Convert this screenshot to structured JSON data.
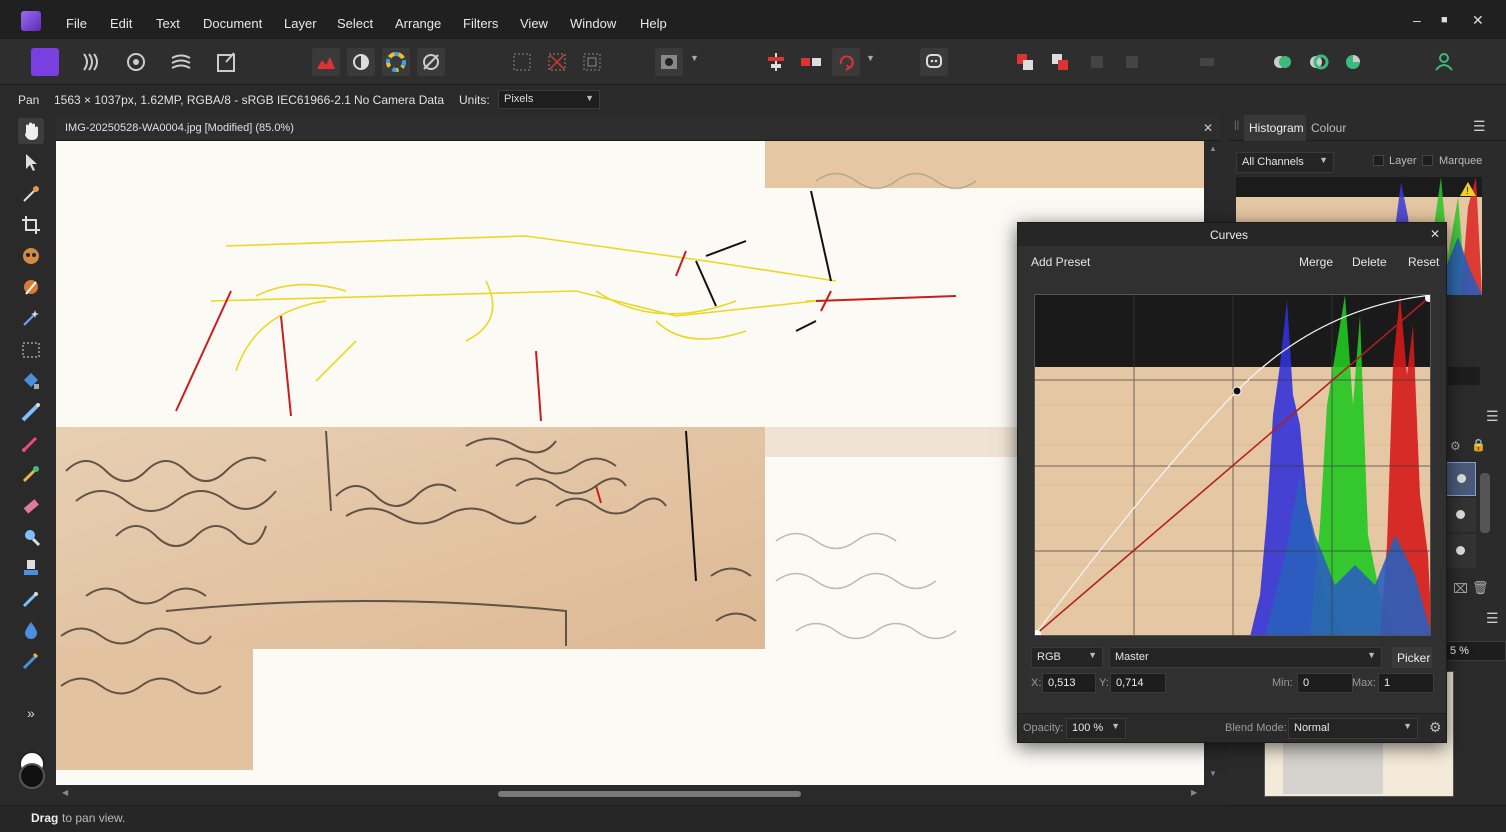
{
  "menubar": {
    "items": [
      "File",
      "Edit",
      "Text",
      "Document",
      "Layer",
      "Select",
      "Arrange",
      "Filters",
      "View",
      "Window",
      "Help"
    ],
    "window_controls": [
      "‒",
      "■",
      "✕"
    ]
  },
  "context": {
    "tool": "Pan",
    "image_info": "1563 × 1037px, 1.62MP, RGBA/8 - sRGB IEC61966-2.1",
    "camera": "No Camera Data",
    "units_label": "Units:",
    "units_value": "Pixels"
  },
  "document": {
    "tab_title": "IMG-20250528-WA0004.jpg [Modified] (85.0%)",
    "close": "✕"
  },
  "histogram_panel": {
    "tabs": [
      "Histogram",
      "Colour"
    ],
    "channel": "All Channels",
    "layer_label": "Layer",
    "marquee_label": "Marquee",
    "layers_opacity_fragment": "5 %"
  },
  "curves": {
    "title": "Curves",
    "close": "✕",
    "add_preset": "Add Preset",
    "merge": "Merge",
    "delete": "Delete",
    "reset": "Reset",
    "colour_space": "RGB",
    "channel": "Master",
    "picker": "Picker",
    "x_label": "X:",
    "x_value": "0,513",
    "y_label": "Y:",
    "y_value": "0,714",
    "min_label": "Min:",
    "min_value": "0",
    "max_label": "Max:",
    "max_value": "1",
    "opacity_label": "Opacity:",
    "opacity_value": "100 %",
    "blend_label": "Blend Mode:",
    "blend_value": "Normal"
  },
  "status": {
    "bold": "Drag",
    "text": "to pan view."
  },
  "colors": {
    "accent": "#b0d9ff",
    "app_bg": "#2a2a2a",
    "paper": "#e6c7a4"
  },
  "icons": {
    "expand_tools": "»"
  }
}
